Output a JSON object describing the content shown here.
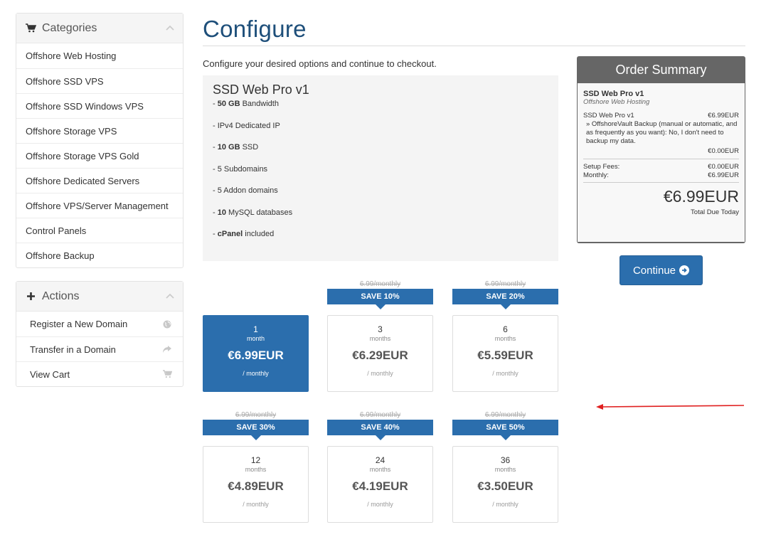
{
  "sidebar": {
    "categories": {
      "title": "Categories",
      "items": [
        {
          "label": "Offshore Web Hosting"
        },
        {
          "label": "Offshore SSD VPS"
        },
        {
          "label": "Offshore SSD Windows VPS"
        },
        {
          "label": "Offshore Storage VPS"
        },
        {
          "label": "Offshore Storage VPS Gold"
        },
        {
          "label": "Offshore Dedicated Servers"
        },
        {
          "label": "Offshore VPS/Server Management"
        },
        {
          "label": "Control Panels"
        },
        {
          "label": "Offshore Backup"
        }
      ]
    },
    "actions": {
      "title": "Actions",
      "items": [
        {
          "label": "Register a New Domain",
          "icon": "globe-icon"
        },
        {
          "label": "Transfer in a Domain",
          "icon": "share-arrow-icon"
        },
        {
          "label": "View Cart",
          "icon": "cart-icon"
        }
      ]
    }
  },
  "main": {
    "title": "Configure",
    "intro": "Configure your desired options and continue to checkout.",
    "product": {
      "name": "SSD Web Pro v1",
      "features": [
        {
          "prefix": "- ",
          "bold": "50 GB",
          "rest": " Bandwidth"
        },
        {
          "prefix": "- ",
          "bold": "",
          "rest": "IPv4 Dedicated IP"
        },
        {
          "prefix": "- ",
          "bold": "10 GB",
          "rest": " SSD"
        },
        {
          "prefix": "- ",
          "bold": "",
          "rest": "5 Subdomains"
        },
        {
          "prefix": "- ",
          "bold": "",
          "rest": "5 Addon domains"
        },
        {
          "prefix": "- ",
          "bold": "10",
          "rest": " MySQL databases"
        },
        {
          "prefix": "- ",
          "bold": "cPanel",
          "rest": " included"
        }
      ]
    },
    "cycles": [
      {
        "num": "1",
        "unit": "month",
        "price": "€6.99EUR",
        "per": "/ monthly",
        "strike": "",
        "save": "",
        "active": true
      },
      {
        "num": "3",
        "unit": "months",
        "price": "€6.29EUR",
        "per": "/ monthly",
        "strike": "6.99/monthly",
        "save": "SAVE 10%",
        "active": false
      },
      {
        "num": "6",
        "unit": "months",
        "price": "€5.59EUR",
        "per": "/ monthly",
        "strike": "6.99/monthly",
        "save": "SAVE 20%",
        "active": false
      },
      {
        "num": "12",
        "unit": "months",
        "price": "€4.89EUR",
        "per": "/ monthly",
        "strike": "6.99/monthly",
        "save": "SAVE 30%",
        "active": false
      },
      {
        "num": "24",
        "unit": "months",
        "price": "€4.19EUR",
        "per": "/ monthly",
        "strike": "6.99/monthly",
        "save": "SAVE 40%",
        "active": false
      },
      {
        "num": "36",
        "unit": "months",
        "price": "€3.50EUR",
        "per": "/ monthly",
        "strike": "6.99/monthly",
        "save": "SAVE 50%",
        "active": false
      }
    ]
  },
  "summary": {
    "title": "Order Summary",
    "product": "SSD Web Pro v1",
    "group": "Offshore Web Hosting",
    "line_label": "SSD Web Pro v1",
    "line_price": "€6.99EUR",
    "addon_text": "» OffshoreVault Backup (manual or automatic, and as frequently as you want): No, I don't need to backup my data.",
    "addon_price": "€0.00EUR",
    "setup_label": "Setup Fees:",
    "setup_value": "€0.00EUR",
    "monthly_label": "Monthly:",
    "monthly_value": "€6.99EUR",
    "total": "€6.99EUR",
    "total_label": "Total Due Today"
  },
  "continue_label": "Continue",
  "colors": {
    "accent": "#2b6ead",
    "title": "#1e4f7a",
    "summary_header": "#666666",
    "annotation_arrow": "#e02020"
  }
}
